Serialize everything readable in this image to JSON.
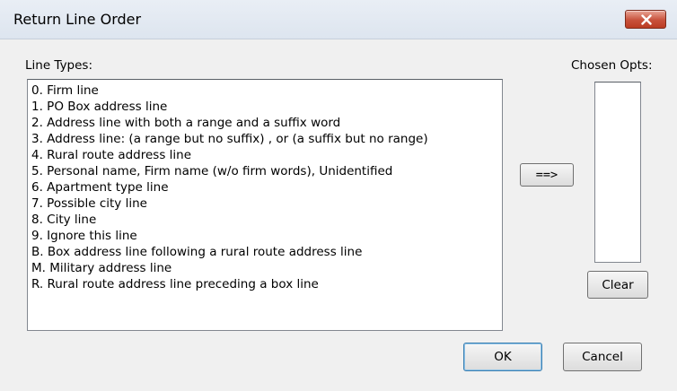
{
  "window": {
    "title": "Return Line Order",
    "close_icon": "close-icon"
  },
  "line_types": {
    "label": "Line Types:",
    "items": [
      "0. Firm line",
      "1. PO Box address line",
      "2. Address line with both a range and a suffix word",
      "3. Address line: (a range but no suffix) , or (a suffix but no range)",
      "4. Rural route address line",
      "5. Personal name, Firm name (w/o firm words), Unidentified",
      "6. Apartment type line",
      "7. Possible city line",
      "8. City line",
      "9. Ignore this line",
      "B. Box address line following a rural route address line",
      "M. Military address line",
      "R. Rural route address line preceding a box line"
    ]
  },
  "chosen_opts": {
    "label": "Chosen Opts:",
    "items": []
  },
  "buttons": {
    "add": "==>",
    "clear": "Clear",
    "ok": "OK",
    "cancel": "Cancel"
  },
  "colors": {
    "dialog_bg": "#f0f0f0",
    "close_button": "#c8513b",
    "default_button_border": "#3c7fb1"
  }
}
